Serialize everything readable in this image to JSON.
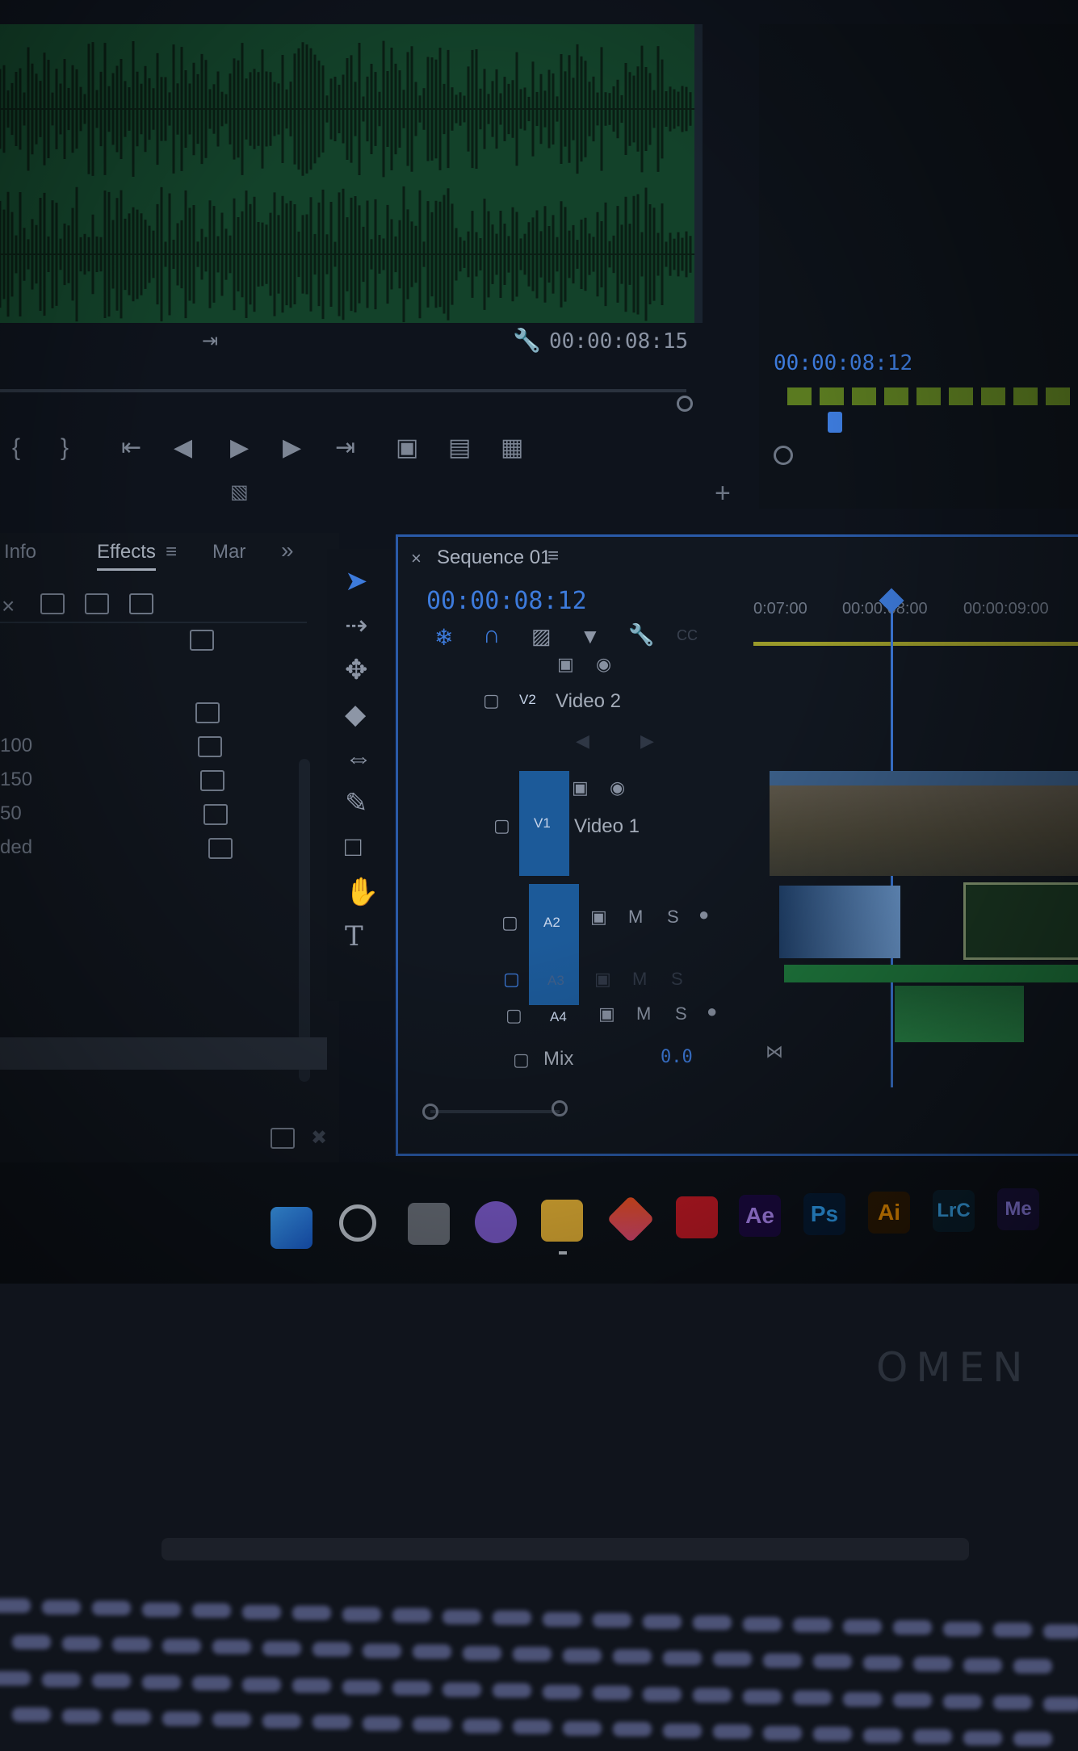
{
  "source_monitor": {
    "timecode": "00:00:08:15"
  },
  "program_monitor": {
    "timecode": "00:00:08:12"
  },
  "effects_panel": {
    "tabs": [
      "Info",
      "Effects",
      "Mar"
    ],
    "overflow_icon": "double-chevron-right-icon",
    "list_partial": [
      "100",
      "150",
      "50",
      "ded"
    ]
  },
  "timeline": {
    "sequence_name": "Sequence 01",
    "timecode": "00:00:08:12",
    "ruler_labels": [
      "0:07:00",
      "00:00:08:00",
      "00:00:09:00"
    ],
    "tracks": {
      "v2": {
        "tag": "V2",
        "label": "Video 2"
      },
      "v1": {
        "tag": "V1",
        "label": "Video 1"
      },
      "a2": {
        "tag": "A2",
        "m": "M",
        "s": "S"
      },
      "a3": {
        "tag": "A3",
        "m": "M",
        "s": "S"
      },
      "a4": {
        "tag": "A4",
        "m": "M",
        "s": "S"
      },
      "mix": {
        "label": "Mix",
        "value": "0.0"
      }
    }
  },
  "taskbar": {
    "apps": [
      {
        "name": "windows-start-icon",
        "text": ""
      },
      {
        "name": "search-icon",
        "text": ""
      },
      {
        "name": "task-view-icon",
        "text": ""
      },
      {
        "name": "chat-icon",
        "text": ""
      },
      {
        "name": "file-explorer-icon",
        "text": ""
      },
      {
        "name": "office-icon",
        "text": ""
      },
      {
        "name": "mcafee-icon",
        "text": ""
      },
      {
        "name": "after-effects-icon",
        "text": "Ae"
      },
      {
        "name": "photoshop-icon",
        "text": "Ps"
      },
      {
        "name": "illustrator-icon",
        "text": "Ai"
      },
      {
        "name": "lightroom-classic-icon",
        "text": "LrC"
      },
      {
        "name": "media-encoder-icon",
        "text": "Me"
      }
    ]
  },
  "laptop": {
    "brand": "OMEN"
  },
  "colors": {
    "accent_blue": "#3d7bdc",
    "waveform_green": "#13422a",
    "track_blue": "#1c5a99"
  }
}
